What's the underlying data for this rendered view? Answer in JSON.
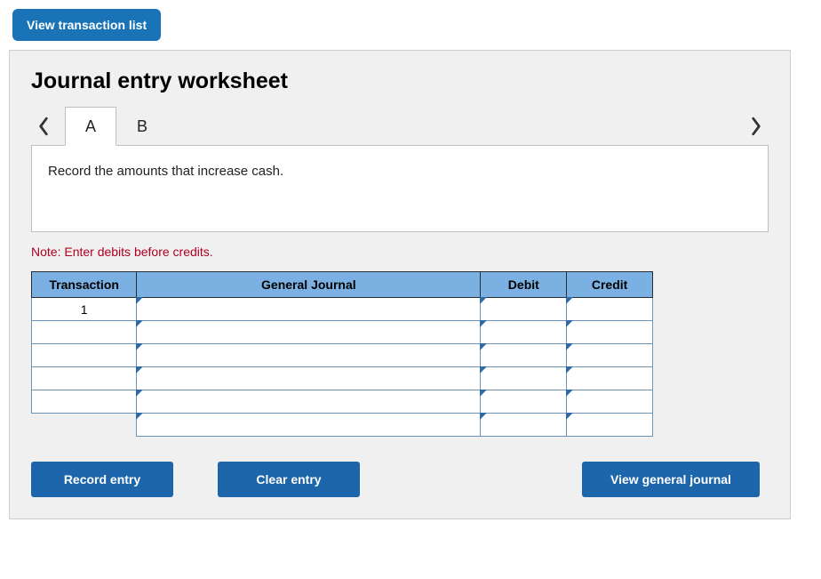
{
  "top_button_label": "View transaction list",
  "heading": "Journal entry worksheet",
  "tabs": {
    "a": "A",
    "b": "B"
  },
  "instruction": "Record the amounts that increase cash.",
  "note": "Note: Enter debits before credits.",
  "table": {
    "headers": {
      "transaction": "Transaction",
      "general_journal": "General Journal",
      "debit": "Debit",
      "credit": "Credit"
    },
    "rows": [
      {
        "tx": "1",
        "gj": "",
        "debit": "",
        "credit": ""
      },
      {
        "tx": "",
        "gj": "",
        "debit": "",
        "credit": ""
      },
      {
        "tx": "",
        "gj": "",
        "debit": "",
        "credit": ""
      },
      {
        "tx": "",
        "gj": "",
        "debit": "",
        "credit": ""
      },
      {
        "tx": "",
        "gj": "",
        "debit": "",
        "credit": ""
      },
      {
        "tx": "",
        "gj": "",
        "debit": "",
        "credit": ""
      }
    ]
  },
  "buttons": {
    "record": "Record entry",
    "clear": "Clear entry",
    "view_gj": "View general journal"
  }
}
